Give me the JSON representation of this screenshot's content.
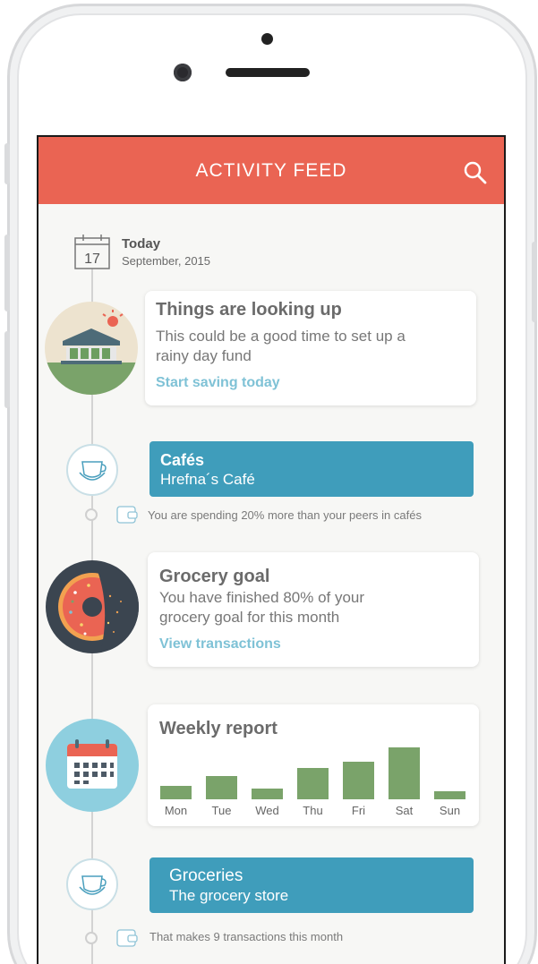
{
  "header": {
    "title": "ACTIVITY FEED"
  },
  "date": {
    "day_number": "17",
    "label": "Today",
    "sub": "September, 2015"
  },
  "cards": {
    "looking_up": {
      "title": "Things are looking up",
      "text_line1": "This could be a good time to set up a",
      "text_line2": "rainy day fund",
      "link": "Start saving today"
    },
    "grocery_goal": {
      "title": "Grocery goal",
      "text_line1": "You have finished 80% of your",
      "text_line2": "grocery goal for this month",
      "link": "View transactions",
      "progress_percent": 80
    },
    "weekly_report": {
      "title": "Weekly report"
    }
  },
  "transactions": [
    {
      "category": "Cafés",
      "merchant": "Hrefna´s Café",
      "note": "You are spending 20% more than your peers in cafés"
    },
    {
      "category": "Groceries",
      "merchant": "The grocery store",
      "note": "That makes 9 transactions this month"
    }
  ],
  "chart_data": {
    "type": "bar",
    "title": "Weekly report",
    "categories": [
      "Mon",
      "Tue",
      "Wed",
      "Thu",
      "Fri",
      "Sat",
      "Sun"
    ],
    "values": [
      16,
      27,
      13,
      37,
      44,
      61,
      9
    ],
    "ylim": [
      0,
      65
    ],
    "grid": false,
    "color": "#7aa36a"
  },
  "colors": {
    "accent": "#ea6453",
    "transaction": "#3f9dbb",
    "link": "#7fc2d6"
  },
  "icons": {
    "search": "search-icon",
    "calendar": "calendar-icon",
    "bank": "bank-icon",
    "coffee": "coffee-cup-icon",
    "donut": "donut-icon",
    "weekly_calendar": "calendar-icon",
    "receipt": "wallet-icon"
  }
}
